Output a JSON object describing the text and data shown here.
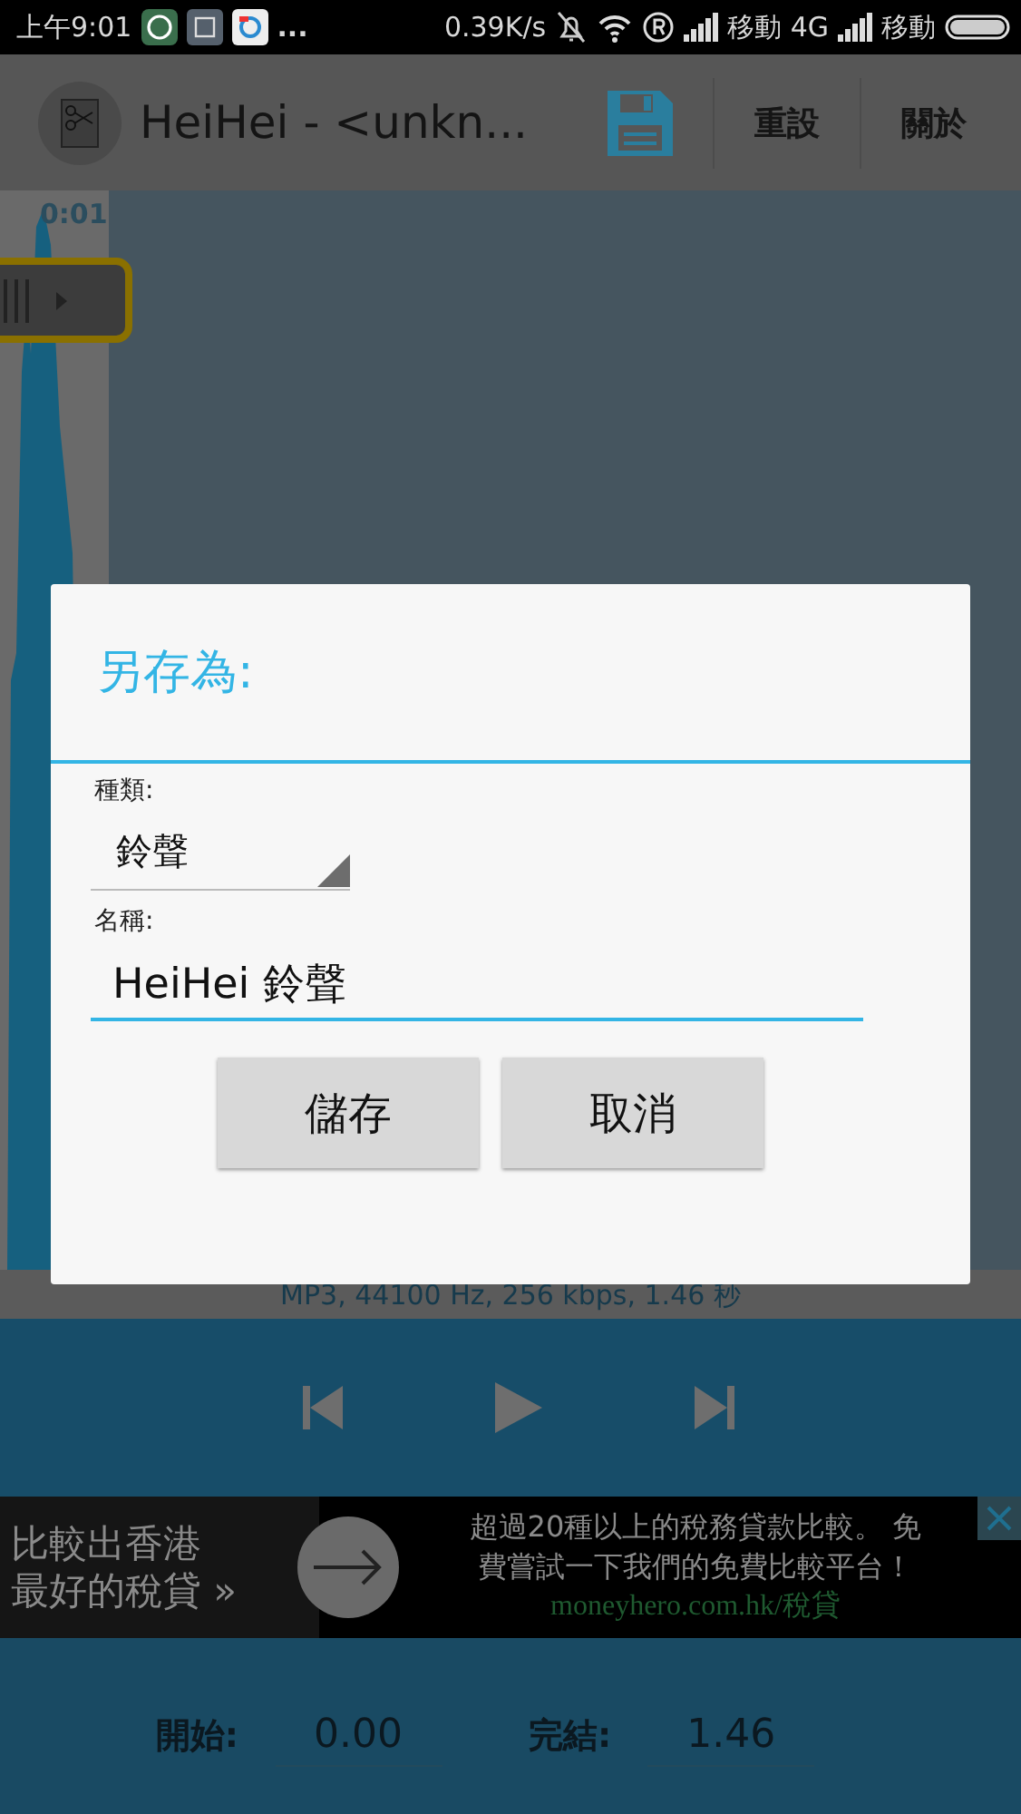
{
  "status_bar": {
    "time": "上午9:01",
    "overflow": "...",
    "speed": "0.39K/s",
    "carrier_1": "移動 4G",
    "carrier_2": "移動"
  },
  "action_bar": {
    "title": "HeiHei - <unkn...",
    "actions": [
      {
        "label": "重設"
      },
      {
        "label": "關於"
      }
    ]
  },
  "waveform": {
    "time_label": "0:01"
  },
  "info": "MP3, 44100 Hz, 256 kbps, 1.46 秒",
  "ad": {
    "headline": [
      "比較出香港",
      "最好的稅貸 »"
    ],
    "body": [
      "超過20種以上的稅務貸款比較。 免",
      "費嘗試一下我們的免費比較平台！"
    ],
    "url": "moneyhero.com.hk/稅貸"
  },
  "range": {
    "start_label": "開始:",
    "start_value": "0.00",
    "end_label": "完結:",
    "end_value": "1.46"
  },
  "dialog": {
    "title": "另存為:",
    "type_label": "種類:",
    "type_value": "鈴聲",
    "name_label": "名稱:",
    "name_value": "HeiHei 鈴聲",
    "buttons": [
      {
        "label": "儲存"
      },
      {
        "label": "取消"
      }
    ]
  }
}
